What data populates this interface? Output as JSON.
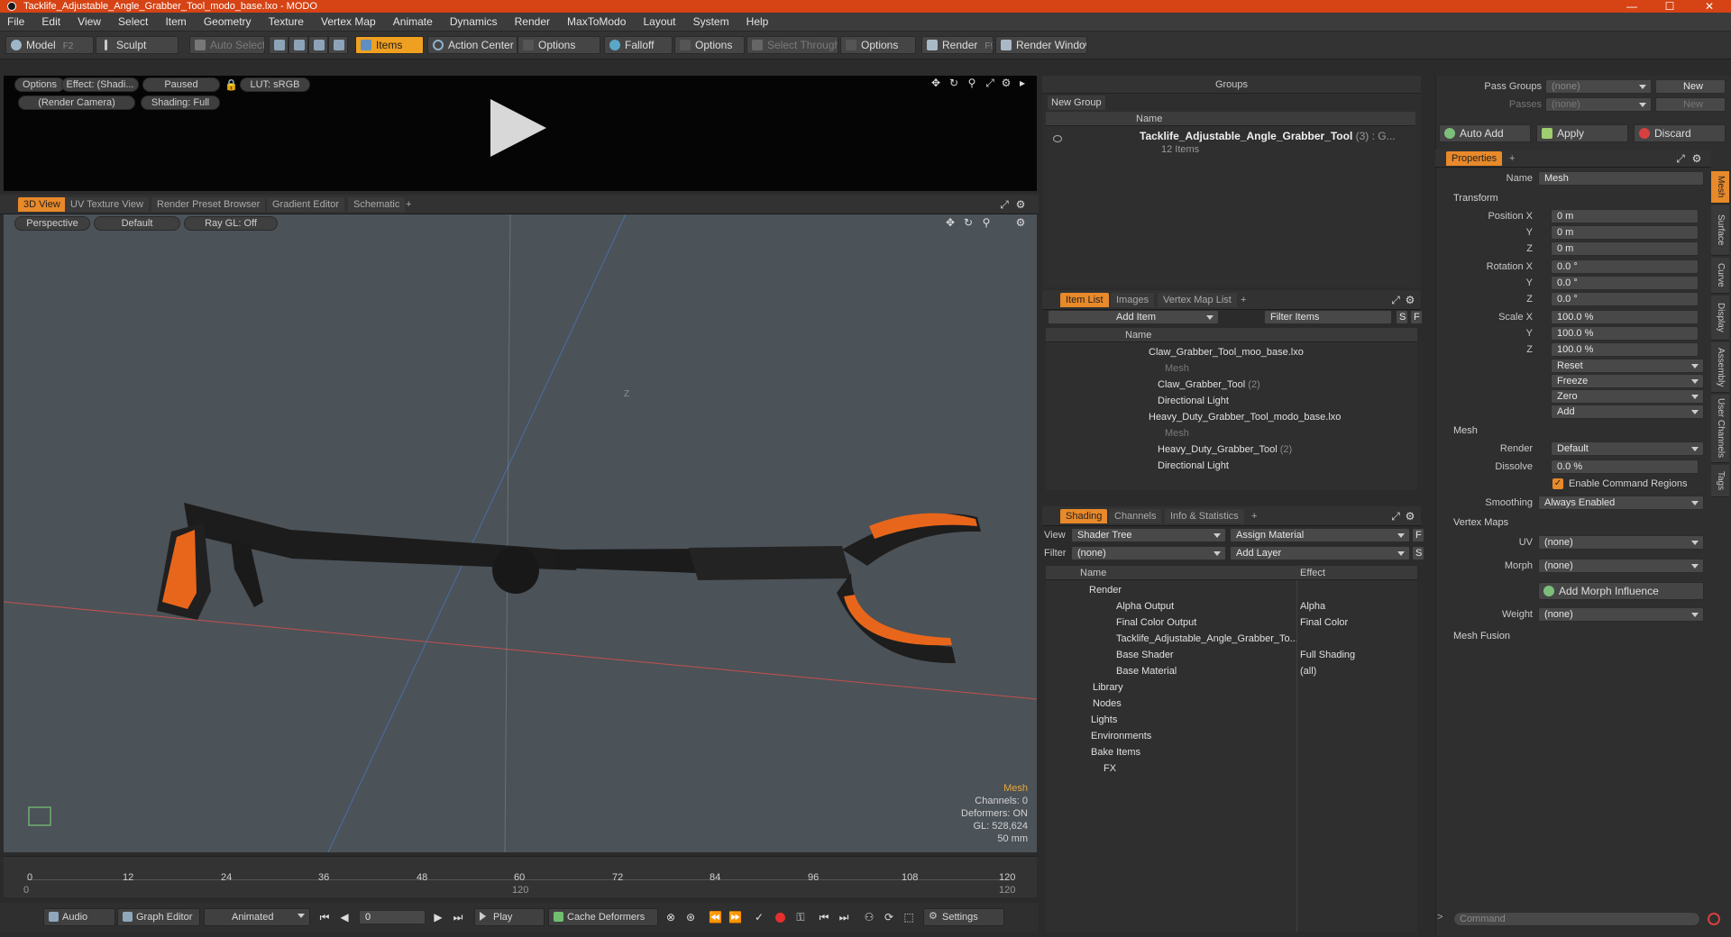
{
  "window": {
    "title": "Tacklife_Adjustable_Angle_Grabber_Tool_modo_base.lxo - MODO",
    "min": "—",
    "max": "☐",
    "close": "✕"
  },
  "menu": [
    "File",
    "Edit",
    "View",
    "Select",
    "Item",
    "Geometry",
    "Texture",
    "Vertex Map",
    "Animate",
    "Dynamics",
    "Render",
    "MaxToModo",
    "Layout",
    "System",
    "Help"
  ],
  "toolbar": {
    "model": "Model",
    "model_key": "F2",
    "sculpt": "Sculpt",
    "auto_select": "Auto Select",
    "items": "Items",
    "action_center": "Action Center",
    "options1": "Options",
    "falloff": "Falloff",
    "options2": "Options",
    "select_through": "Select Through",
    "options3": "Options",
    "render": "Render",
    "render_key": "F9",
    "render_window": "Render Window"
  },
  "preview": {
    "options": "Options",
    "effect": "Effect: (Shadi...",
    "paused": "Paused",
    "lut": "LUT: sRGB",
    "camera": "(Render Camera)",
    "shading": "Shading: Full"
  },
  "viewport_tabs": [
    "3D View",
    "UV Texture View",
    "Render Preset Browser",
    "Gradient Editor",
    "Schematic",
    "+"
  ],
  "viewport": {
    "perspective": "Perspective",
    "default": "Default",
    "raygl": "Ray GL: Off",
    "info_title": "Mesh",
    "channels": "Channels: 0",
    "deformers": "Deformers: ON",
    "gl": "GL: 528,624",
    "focal": "50 mm",
    "axis_z": "Z"
  },
  "timeline": {
    "ticks": [
      "0",
      "12",
      "24",
      "36",
      "48",
      "60",
      "72",
      "84",
      "96",
      "108",
      "120"
    ],
    "sub_left": "0",
    "sub_mid": "120",
    "sub_right": "120"
  },
  "bottom": {
    "audio": "Audio",
    "graph_editor": "Graph Editor",
    "animated": "Animated",
    "frame": "0",
    "play": "Play",
    "cache": "Cache Deformers",
    "settings": "Settings",
    "command": "Command"
  },
  "groups": {
    "title": "Groups",
    "new_group": "New Group",
    "col_name": "Name",
    "item": "Tacklife_Adjustable_Angle_Grabber_Tool",
    "item_suffix": "(3) : G...",
    "item_count": "12 Items"
  },
  "itemlist": {
    "tabs": [
      "Item List",
      "Images",
      "Vertex Map List",
      "+"
    ],
    "add_item": "Add Item",
    "filter": "Filter Items",
    "s": "S",
    "f": "F",
    "col_name": "Name",
    "rows": [
      {
        "label": "Claw_Grabber_Tool_moo_base.lxo",
        "indent": 0,
        "dim": false,
        "suffix": ""
      },
      {
        "label": "Mesh",
        "indent": 2,
        "dim": true,
        "suffix": ""
      },
      {
        "label": "Claw_Grabber_Tool",
        "indent": 1,
        "dim": false,
        "suffix": "(2)"
      },
      {
        "label": "Directional Light",
        "indent": 1,
        "dim": false,
        "suffix": ""
      },
      {
        "label": "Heavy_Duty_Grabber_Tool_modo_base.lxo",
        "indent": 0,
        "dim": false,
        "suffix": ""
      },
      {
        "label": "Mesh",
        "indent": 2,
        "dim": true,
        "suffix": ""
      },
      {
        "label": "Heavy_Duty_Grabber_Tool",
        "indent": 1,
        "dim": false,
        "suffix": "(2)"
      },
      {
        "label": "Directional Light",
        "indent": 1,
        "dim": false,
        "suffix": ""
      }
    ]
  },
  "shading": {
    "tabs": [
      "Shading",
      "Channels",
      "Info & Statistics",
      "+"
    ],
    "view_label": "View",
    "view_value": "Shader Tree",
    "assign": "Assign Material",
    "f": "F",
    "filter_label": "Filter",
    "filter_value": "(none)",
    "add_layer": "Add Layer",
    "s": "S",
    "col_name": "Name",
    "col_effect": "Effect",
    "rows": [
      {
        "label": "Render",
        "effect": "",
        "indent": 0
      },
      {
        "label": "Alpha Output",
        "effect": "Alpha",
        "indent": 1
      },
      {
        "label": "Final Color Output",
        "effect": "Final Color",
        "indent": 1
      },
      {
        "label": "Tacklife_Adjustable_Angle_Grabber_To...",
        "effect": "",
        "indent": 1
      },
      {
        "label": "Base Shader",
        "effect": "Full Shading",
        "indent": 1
      },
      {
        "label": "Base Material",
        "effect": "(all)",
        "indent": 1
      },
      {
        "label": "Library",
        "effect": "",
        "indent": 0
      },
      {
        "label": "Nodes",
        "effect": "",
        "indent": 0
      },
      {
        "label": "Lights",
        "effect": "",
        "indent": 0
      },
      {
        "label": "Environments",
        "effect": "",
        "indent": 0
      },
      {
        "label": "Bake Items",
        "effect": "",
        "indent": 0
      },
      {
        "label": "FX",
        "effect": "",
        "indent": 0
      }
    ]
  },
  "passes": {
    "pass_groups": "Pass Groups",
    "pass_groups_value": "(none)",
    "new1": "New",
    "passes": "Passes",
    "passes_value": "(none)",
    "new2": "New",
    "auto_add": "Auto Add",
    "apply": "Apply",
    "discard": "Discard"
  },
  "properties": {
    "tab": "Properties",
    "plus": "+",
    "name_label": "Name",
    "name_value": "Mesh",
    "transform": "Transform",
    "pos_label": "Position X",
    "pos": [
      "0 m",
      "0 m",
      "0 m"
    ],
    "rot_label": "Rotation X",
    "rot": [
      "0.0 °",
      "0.0 °",
      "0.0 °"
    ],
    "scale_label": "Scale X",
    "scale": [
      "100.0 %",
      "100.0 %",
      "100.0 %"
    ],
    "y": "Y",
    "z": "Z",
    "reset": "Reset",
    "freeze": "Freeze",
    "zero": "Zero",
    "add": "Add",
    "mesh": "Mesh",
    "render_label": "Render",
    "render_value": "Default",
    "dissolve_label": "Dissolve",
    "dissolve_value": "0.0 %",
    "enable_cmd": "Enable Command Regions",
    "smoothing_label": "Smoothing",
    "smoothing_value": "Always Enabled",
    "vertex_maps": "Vertex Maps",
    "uv_label": "UV",
    "uv_value": "(none)",
    "morph_label": "Morph",
    "morph_value": "(none)",
    "add_morph": "Add Morph Influence",
    "weight_label": "Weight",
    "weight_value": "(none)",
    "mesh_fusion": "Mesh Fusion",
    "side_tabs": [
      "Mesh",
      "Surface",
      "Curve",
      "Display",
      "Assembly",
      "User Channels",
      "Tags"
    ]
  },
  "colors": {
    "title_bar": "#d64314",
    "accent": "#e8892a",
    "viewport_bg": "#4b5258",
    "mesh_orange": "#e8661b"
  }
}
